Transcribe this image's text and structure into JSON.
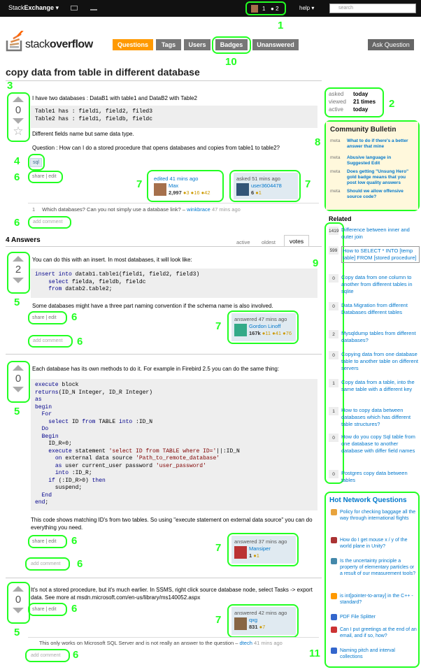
{
  "topbar": {
    "brand_a": "Stack",
    "brand_b": "Exchange",
    "rep": "1",
    "badges": "2",
    "help": "help",
    "search_placeholder": "search"
  },
  "logo": {
    "a": "stack",
    "b": "overflow"
  },
  "nav": [
    {
      "label": "Questions",
      "color": "#ff9900"
    },
    {
      "label": "Tags",
      "color": "#777777"
    },
    {
      "label": "Users",
      "color": "#777777"
    },
    {
      "label": "Badges",
      "color": "#777777"
    },
    {
      "label": "Unanswered",
      "color": "#777777"
    }
  ],
  "ask": "Ask Question",
  "markers": [
    "1",
    "2",
    "3",
    "4",
    "5",
    "5",
    "5",
    "5",
    "6",
    "6",
    "6",
    "6",
    "6",
    "6",
    "6",
    "6",
    "6",
    "7",
    "7",
    "7",
    "7",
    "7",
    "7",
    "8",
    "9",
    "10",
    "11"
  ],
  "question": {
    "title": "copy data from table in different database",
    "votes": "0",
    "p1": "I have two databases : DataB1 with table1 and DataB2 with Table2",
    "code": "Table1 has : field1, field2, filed3\nTable2 has : field1, fieldb, fieldc",
    "p2": "Different fields name but same data type.",
    "p3": "Question : How can I do a stored procedure that opens databases and copies from table1 to table2?",
    "tag": "sql",
    "share": "share",
    "edit": "edit",
    "edited": "edited 41 mins ago",
    "editor": "Max",
    "editor_rep": "2,997",
    "editor_badges": "●3 ●16 ●42",
    "asked": "asked 51 mins ago",
    "asker": "user3604478",
    "asker_rep": "6",
    "asker_badges": "●1",
    "comment_n": "1",
    "comment": "Which databases? Can you not simply use a database link? –",
    "comment_user": "winkbrace",
    "comment_time": "47 mins ago",
    "add_comment": "add comment"
  },
  "stats": {
    "asked_l": "asked",
    "asked_v": "today",
    "viewed_l": "viewed",
    "viewed_v": "21 times",
    "active_l": "active",
    "active_v": "today"
  },
  "answers_header": {
    "count": "4 Answers",
    "tab_active": "active",
    "tab_oldest": "oldest",
    "tab_votes": "votes"
  },
  "a1": {
    "votes": "2",
    "p1": "You can do this with an insert. In most databases, it will look like:",
    "p2": "Some databases might have a three part naming convention if the schema name is also involved.",
    "answered": "answered 47 mins ago",
    "user": "Gordon Linoff",
    "rep": "167k",
    "badges": "●11 ●41 ●76"
  },
  "a2": {
    "votes": "0",
    "p1": "Each database has its own methods to do it. For example in Firebird 2.5 you can do the same thing:",
    "p2": "This code shows matching ID's from two tables. So using \"execute statement on external data source\" you can do everything you need.",
    "answered": "answered 37 mins ago",
    "user": "Mansiper",
    "rep": "1",
    "badges": "●1"
  },
  "a3": {
    "votes": "0",
    "p1": "It's not a stored procedure, but it's much earlier. In SSMS, right click source database node, select Tasks -> export data. See more at msdn.microsoft.com/en-us/library/ms140052.aspx",
    "answered": "answered 42 mins ago",
    "user": "qxg",
    "rep": "831",
    "badges": "●7",
    "comment": "This only works on Microsoft SQL Server and is not really an answer to the question –",
    "comment_user": "dtech",
    "comment_time": "41 mins ago"
  },
  "bulletin": {
    "title": "Community Bulletin",
    "items": [
      {
        "meta": "meta",
        "text": "What to do if there's a better answer that mine"
      },
      {
        "meta": "meta",
        "text": "Abusive language in Suggested Edit"
      },
      {
        "meta": "meta",
        "text": "Does getting \"Unsung Hero\" gold badge means that you post low quality answers"
      },
      {
        "meta": "meta",
        "text": "Should we allow offensive source code?"
      }
    ]
  },
  "related": {
    "title": "Related",
    "items": [
      {
        "count": "1419",
        "text": "Difference between inner and outer join"
      },
      {
        "count": "599",
        "text": "How to SELECT * INTO [temp table] FROM [stored procedure]"
      },
      {
        "count": "0",
        "text": "Copy data from one column to another from different tables in sqlite"
      },
      {
        "count": "0",
        "text": "Data Migration from different Databases different tables"
      },
      {
        "count": "2",
        "text": "Mysqldump tables from different databases?"
      },
      {
        "count": "0",
        "text": "Copying data from one database table to another table on different servers"
      },
      {
        "count": "1",
        "text": "Copy data from a table, into the same table with a different key"
      },
      {
        "count": "1",
        "text": "How to copy data between databases which has different table structures?"
      },
      {
        "count": "0",
        "text": "How do you copy Sql table from one database to another database with differ field names"
      },
      {
        "count": "0",
        "text": "Postgres copy data between tables"
      }
    ]
  },
  "hnq": {
    "title": "Hot Network Questions",
    "items": [
      {
        "text": "Policy for checking baggage all the way through international flights",
        "color": "#e8a33d"
      },
      {
        "text": "How do I get mouse x / y of the world plane in Unity?",
        "color": "#a33"
      },
      {
        "text": "Is the uncertainty principle a property of elementary particles or a result of our measurement tools?",
        "color": "#48a"
      },
      {
        "text": "is int[pointer-to-array] in the C++ - standard?",
        "color": "#f90"
      },
      {
        "text": "PDF File Splitter",
        "color": "#36c"
      },
      {
        "text": "Can I put greetings at the end of an email, and if so, how?",
        "color": "#c33"
      },
      {
        "text": "Naming pitch and interval collections",
        "color": "#36c"
      }
    ]
  }
}
